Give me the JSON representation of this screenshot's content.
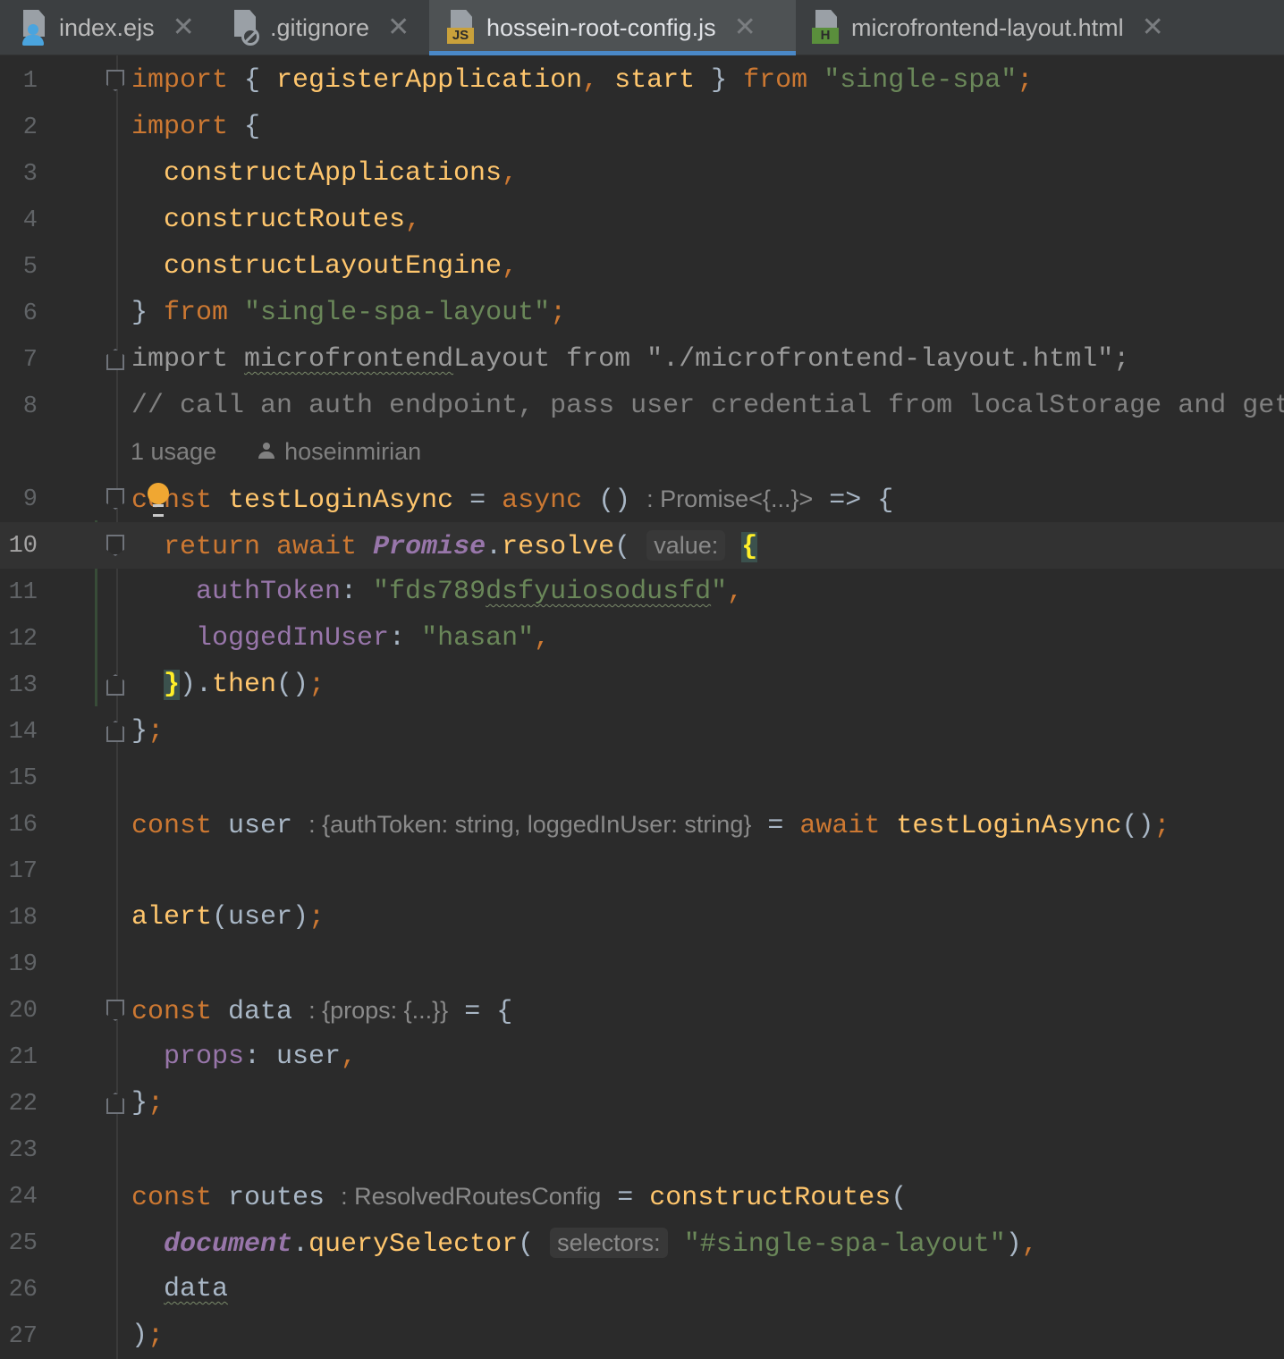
{
  "tabs": [
    {
      "label": "index.ejs",
      "icon": "ejs-file-icon"
    },
    {
      "label": ".gitignore",
      "icon": "ignore-file-icon"
    },
    {
      "label": "hossein-root-config.js",
      "icon": "js-file-icon",
      "badge": "JS",
      "active": true
    },
    {
      "label": "microfrontend-layout.html",
      "icon": "html-file-icon",
      "badge": "H"
    }
  ],
  "close_glyph": "✕",
  "line_numbers": [
    "1",
    "2",
    "3",
    "4",
    "5",
    "6",
    "7",
    "8",
    "9",
    "10",
    "11",
    "12",
    "13",
    "14",
    "15",
    "16",
    "17",
    "18",
    "19",
    "20",
    "21",
    "22",
    "23",
    "24",
    "25",
    "26",
    "27"
  ],
  "code": {
    "l1": {
      "kw": "import",
      "p1": " { ",
      "id1": "registerApplication",
      "comma": ",",
      "sp": " ",
      "id2": "start",
      "p2": " } ",
      "kw2": "from",
      "sp2": " ",
      "str": "\"single-spa\"",
      "semi": ";"
    },
    "l2": {
      "kw": "import",
      "p1": " {"
    },
    "l3": {
      "id": "constructApplications",
      "comma": ","
    },
    "l4": {
      "id": "constructRoutes",
      "comma": ","
    },
    "l5": {
      "id": "constructLayoutEngine",
      "comma": ","
    },
    "l6": {
      "p1": "} ",
      "kw": "from",
      "sp": " ",
      "str": "\"single-spa-layout\"",
      "semi": ";"
    },
    "l7": {
      "text1": "import ",
      "wavy": "microfrontend",
      "text2": "Layout from \"./microfrontend-layout.html\";"
    },
    "l8": {
      "comment": "// call an auth endpoint, pass user credential from localStorage and get"
    },
    "usage": {
      "count": "1 usage",
      "author": "hoseinmirian"
    },
    "l9": {
      "kw": "const",
      "sp": " ",
      "id": "testLoginAsync",
      "op": " = ",
      "kw2": "async",
      "p1": " ()",
      "hint": ": Promise<{...}>",
      "arrow": " => {"
    },
    "l10": {
      "kw": "return",
      "sp": " ",
      "kw2": "await",
      "sp2": " ",
      "cls": "Promise",
      "dot": ".",
      "fn": "resolve",
      "paren": "(",
      "hint": "value:",
      "brace": "{"
    },
    "l11": {
      "prop": "authToken",
      "colon": ": ",
      "str1": "\"fds789",
      "str_wavy": "dsfyuiosodusfd",
      "str2": "\"",
      "comma": ","
    },
    "l12": {
      "prop": "loggedInUser",
      "colon": ": ",
      "str": "\"hasan\"",
      "comma": ","
    },
    "l13": {
      "brace": "}",
      "p1": ").",
      "fn": "then",
      "p2": "()",
      "semi": ";"
    },
    "l14": {
      "p1": "}",
      "semi": ";"
    },
    "l16": {
      "kw": "const",
      "sp": " ",
      "id": "user",
      "hint": ": {authToken: string, loggedInUser: string}",
      "op": " = ",
      "kw2": "await",
      "sp2": " ",
      "fn": "testLoginAsync",
      "p1": "()",
      "semi": ";"
    },
    "l18": {
      "fn": "alert",
      "p1": "(user)",
      "semi": ";"
    },
    "l20": {
      "kw": "const",
      "sp": " ",
      "id": "data",
      "hint": ": {props: {...}}",
      "op": " = {"
    },
    "l21": {
      "prop": "props",
      "p1": ": user",
      "comma": ","
    },
    "l22": {
      "p1": "}",
      "semi": ";"
    },
    "l24": {
      "kw": "const",
      "sp": " ",
      "id": "routes",
      "hint": ": ResolvedRoutesConfig",
      "op": " = ",
      "fn": "constructRoutes",
      "p1": "("
    },
    "l25": {
      "cls": "document",
      "dot": ".",
      "fn": "querySelector",
      "paren": "(",
      "hint": "selectors:",
      "str": "\"#single-spa-layout\"",
      "p1": ")",
      "comma": ","
    },
    "l26": {
      "wavy": "data"
    },
    "l27": {
      "p1": ")",
      "semi": ";"
    }
  },
  "colors": {
    "background": "#2b2b2b",
    "keyword": "#cc7832",
    "string": "#6a8759",
    "function": "#ffc66d",
    "property": "#9876aa",
    "comment": "#808080",
    "tab_underline": "#4a88c7"
  }
}
